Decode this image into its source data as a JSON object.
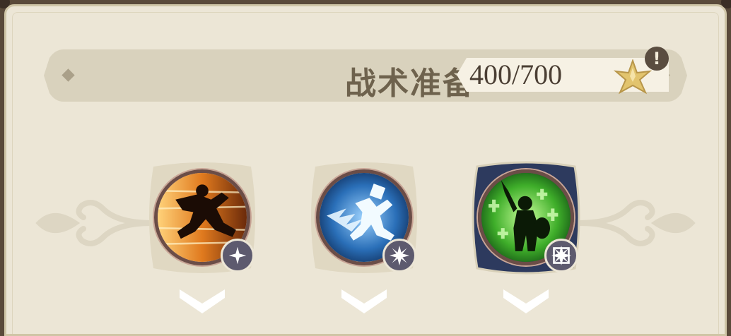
{
  "header": {
    "title": "战术准备",
    "points": "400/700",
    "points_icon": "gold-star-icon",
    "alert_icon": "exclamation-icon",
    "alert_symbol": "!"
  },
  "skills": [
    {
      "name": "sprint-skill",
      "theme": "orange",
      "badge": "sparkle-icon"
    },
    {
      "name": "dash-skill",
      "theme": "blue",
      "badge": "burst-icon"
    },
    {
      "name": "guard-skill",
      "theme": "green",
      "badge": "burst-frame-icon",
      "selected": true
    }
  ],
  "colors": {
    "panel_bg": "#ece6d6",
    "header_bg": "#d9d2bd",
    "title_text": "#6e624d",
    "selected_frame": "#2d3a5e",
    "badge_bg": "#5d5a6e"
  }
}
